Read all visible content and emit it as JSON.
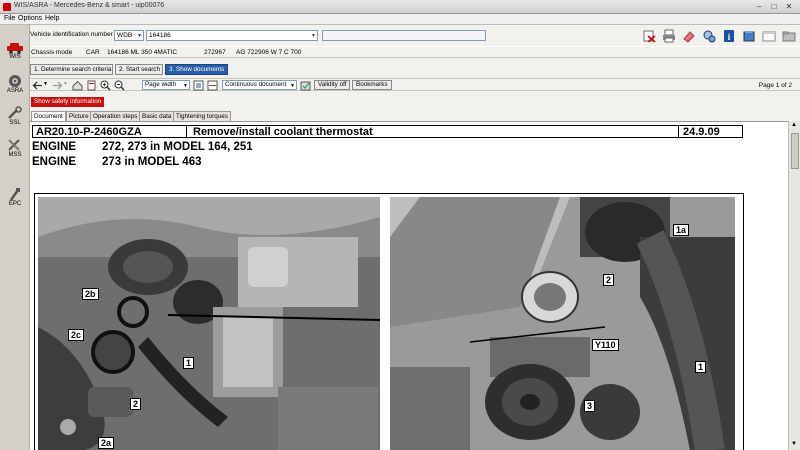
{
  "window": {
    "title": "WIS/ASRA - Mercedes-Benz & smart - uip00076"
  },
  "menu": [
    "File",
    "Options",
    "Help"
  ],
  "nav": [
    {
      "id": "wis",
      "label": "WIS"
    },
    {
      "id": "asra",
      "label": "ASRA"
    },
    {
      "id": "ssl",
      "label": "SSL"
    },
    {
      "id": "mss",
      "label": "MSS"
    },
    {
      "id": "epc",
      "label": "EPC"
    }
  ],
  "vin": {
    "label": "Vehicle identification number",
    "prefix": "WDB",
    "value": "164186",
    "extra": ""
  },
  "chassis": {
    "mode_label": "Chassis mode",
    "type": "CAR",
    "model": "164186 ML 350 4MATIC",
    "engine": "272967",
    "transmission": "AG 722906 W 7 C 700"
  },
  "steps": [
    {
      "label": "1. Determine search criteria",
      "active": false
    },
    {
      "label": "2. Start search",
      "active": false
    },
    {
      "label": "3. Show documents",
      "active": true
    }
  ],
  "doc_toolbar": {
    "zoom": "Page width",
    "view": "Continuous document",
    "validity_button": "Validity off",
    "bookmarks_button": "Bookmarks",
    "page_info": "Page  1  of  2"
  },
  "safety_button": "Show safety information",
  "tabs": [
    {
      "label": "Document",
      "active": true
    },
    {
      "label": "Picture",
      "active": false
    },
    {
      "label": "Operation steps",
      "active": false
    },
    {
      "label": "Basic data",
      "active": false
    },
    {
      "label": "Tightening torques",
      "active": false
    }
  ],
  "document": {
    "doc_id": "AR20.10-P-2460GZA",
    "title": "Remove/install coolant thermostat",
    "date": "24.9.09",
    "engine_lines": [
      {
        "label": "ENGINE",
        "text": "272, 273 in MODEL 164, 251"
      },
      {
        "label": "ENGINE",
        "text": "273 in MODEL 463"
      }
    ],
    "left_callouts": [
      "2b",
      "2c",
      "1",
      "2",
      "2a"
    ],
    "right_callouts": [
      "1a",
      "2",
      "Y110",
      "1",
      "3"
    ]
  }
}
